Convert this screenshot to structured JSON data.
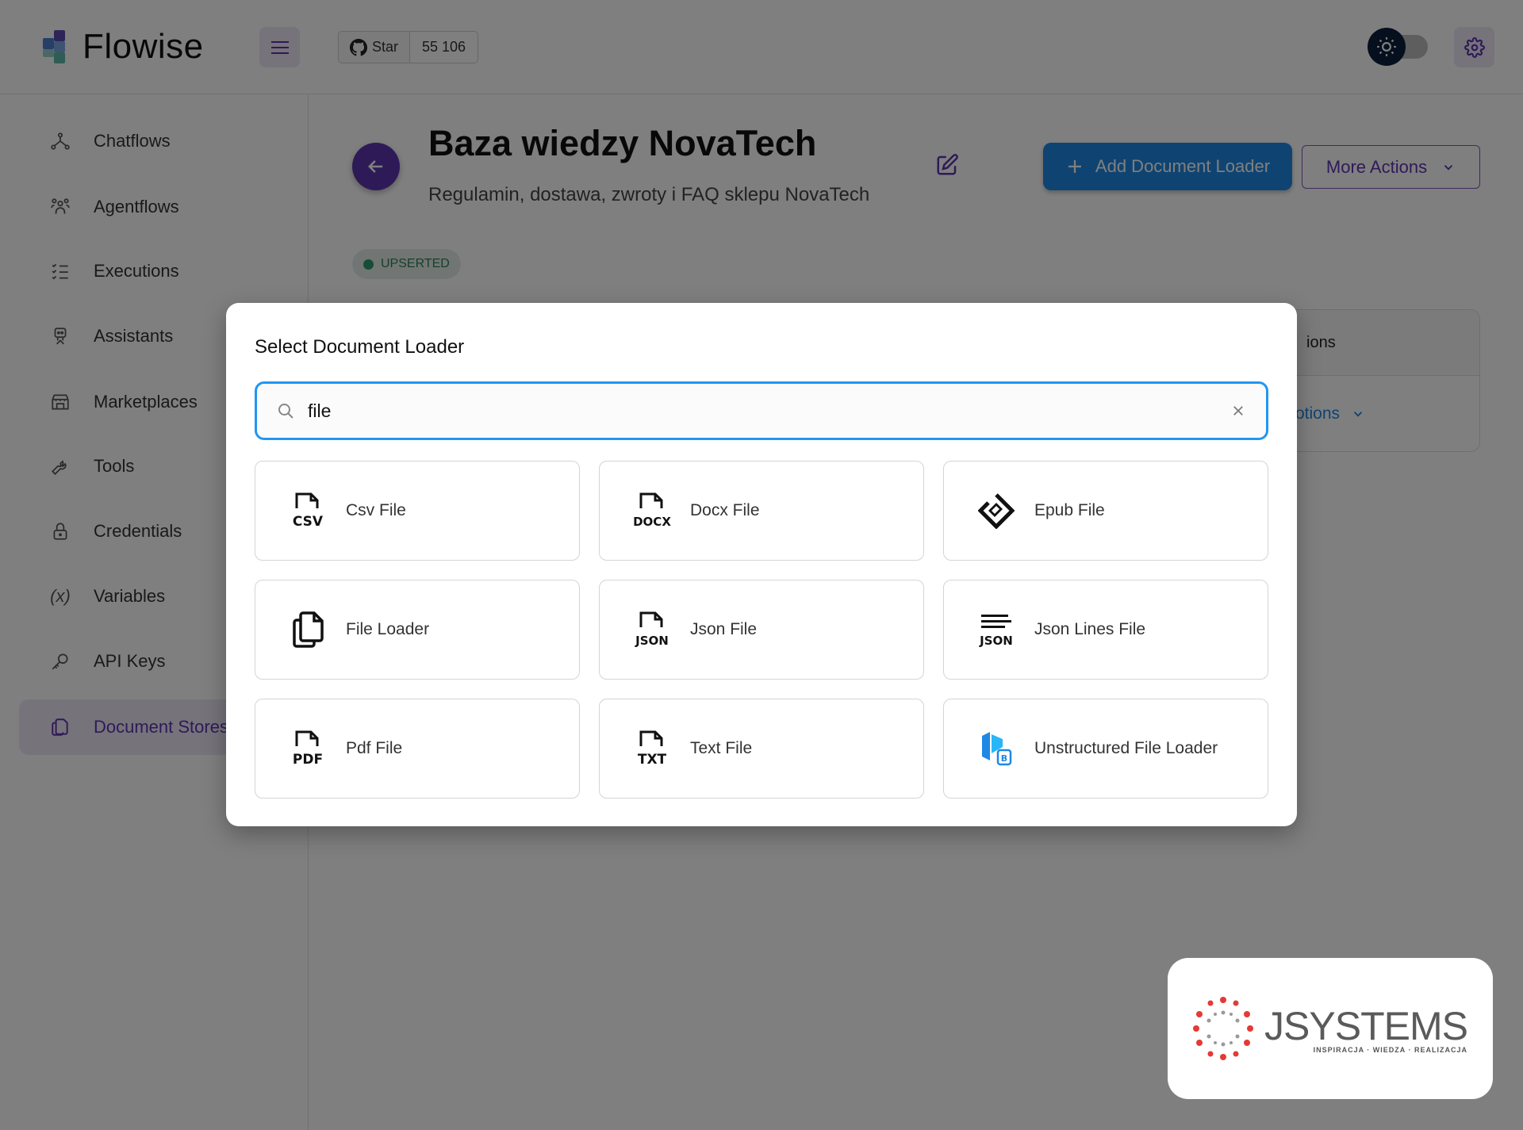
{
  "header": {
    "app_name": "Flowise",
    "github_star_label": "Star",
    "github_star_count": "55 106"
  },
  "sidebar": {
    "items": [
      {
        "label": "Chatflows",
        "icon": "chatflows-icon",
        "active": false
      },
      {
        "label": "Agentflows",
        "icon": "agentflows-icon",
        "active": false
      },
      {
        "label": "Executions",
        "icon": "executions-icon",
        "active": false
      },
      {
        "label": "Assistants",
        "icon": "assistants-icon",
        "active": false
      },
      {
        "label": "Marketplaces",
        "icon": "marketplace-icon",
        "active": false
      },
      {
        "label": "Tools",
        "icon": "tools-icon",
        "active": false
      },
      {
        "label": "Credentials",
        "icon": "lock-icon",
        "active": false
      },
      {
        "label": "Variables",
        "icon": "variables-icon",
        "active": false
      },
      {
        "label": "API Keys",
        "icon": "key-icon",
        "active": false
      },
      {
        "label": "Document Stores",
        "icon": "document-stores-icon",
        "active": true
      }
    ]
  },
  "main": {
    "title": "Baza wiedzy NovaTech",
    "subtitle": "Regulamin, dostawa, zwroty i FAQ sklepu NovaTech",
    "add_button_label": "Add Document Loader",
    "more_actions_label": "More Actions",
    "status_label": "UPSERTED",
    "table_header_partial": "ions",
    "table_cell_partial": "otions"
  },
  "dialog": {
    "title": "Select Document Loader",
    "search_value": "file",
    "loaders": [
      {
        "label": "Csv File",
        "icon": "csv-file-icon"
      },
      {
        "label": "Docx File",
        "icon": "docx-file-icon"
      },
      {
        "label": "Epub File",
        "icon": "epub-file-icon"
      },
      {
        "label": "File Loader",
        "icon": "file-loader-icon"
      },
      {
        "label": "Json File",
        "icon": "json-file-icon"
      },
      {
        "label": "Json Lines File",
        "icon": "json-lines-file-icon"
      },
      {
        "label": "Pdf File",
        "icon": "pdf-file-icon"
      },
      {
        "label": "Text File",
        "icon": "txt-file-icon"
      },
      {
        "label": "Unstructured File Loader",
        "icon": "unstructured-file-loader-icon"
      }
    ]
  },
  "watermark": {
    "brand": "JSYSTEMS",
    "tagline": "INSPIRACJA · WIEDZA · REALIZACJA"
  },
  "colors": {
    "primary_purple": "#5e35b1",
    "accent_blue": "#1e88e5",
    "status_green": "#2e9b6e"
  }
}
